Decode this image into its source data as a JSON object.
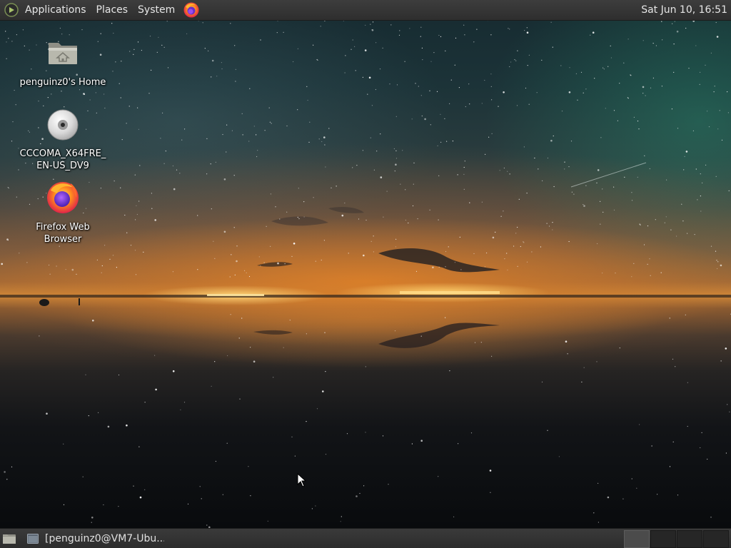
{
  "top_panel": {
    "menus": [
      {
        "label": "Applications"
      },
      {
        "label": "Places"
      },
      {
        "label": "System"
      }
    ],
    "launcher_icon": "firefox-icon",
    "clock": "Sat Jun 10, 16:51"
  },
  "desktop": {
    "icons": [
      {
        "label": "penguinz0's Home",
        "icon": "home-folder-icon"
      },
      {
        "label": "CCCOMA_X64FRE_\nEN-US_DV9",
        "icon": "optical-disc-icon"
      },
      {
        "label": "Firefox Web\nBrowser",
        "icon": "firefox-icon"
      }
    ]
  },
  "bottom_panel": {
    "show_desktop_icon": "show-desktop-icon",
    "tasks": [
      {
        "label": "[penguinz0@VM7-Ubu...",
        "icon": "terminal-window-icon"
      }
    ],
    "workspaces": {
      "count": 4,
      "active": 1
    }
  },
  "colors": {
    "panel": "#333333",
    "panel_text": "#e6e6e6",
    "icon_text": "#ffffff"
  }
}
